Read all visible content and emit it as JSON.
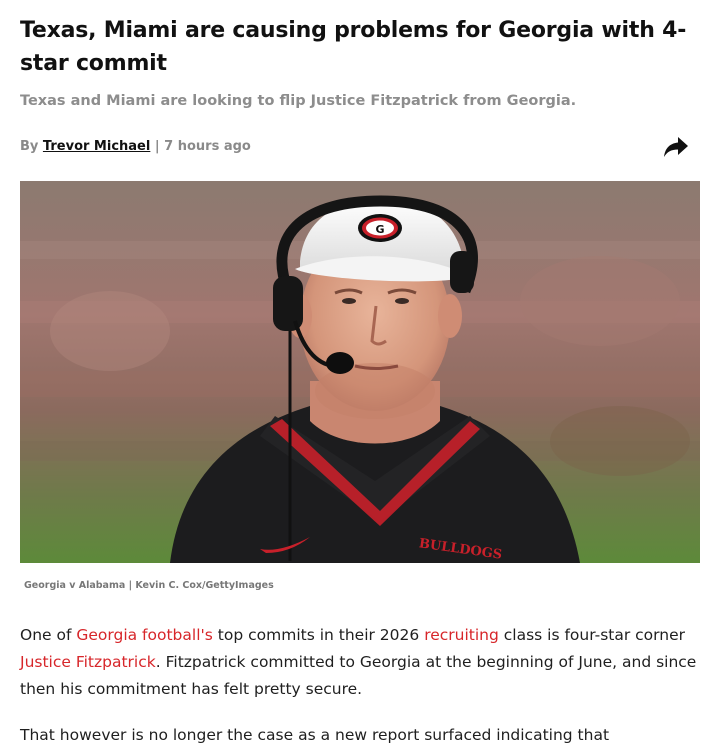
{
  "article": {
    "headline": "Texas, Miami are causing problems for Georgia with 4-star commit",
    "subheadline": "Texas and Miami are looking to flip Justice Fitzpatrick from Georgia.",
    "byline": {
      "prefix": "By",
      "author": "Trevor Michael",
      "separator": "|",
      "time": "7 hours ago"
    },
    "share_icon": "share-arrow-icon",
    "image": {
      "caption": "Georgia v Alabama | Kevin C. Cox/GettyImages",
      "visor_logo": "G",
      "shirt_text": "BULLDOGS"
    },
    "paragraph1": {
      "t1": "One of ",
      "link1": "Georgia football's",
      "t2": " top commits in their 2026 ",
      "link2": "recruiting",
      "t3": " class is four-star corner ",
      "link3": "Justice Fitzpatrick",
      "t4": ". Fitzpatrick committed to Georgia at the beginning of June, and since then his commitment has felt pretty secure."
    },
    "paragraph2": {
      "text": "That however is no longer the case as a new report surfaced indicating that"
    }
  },
  "colors": {
    "link": "#d7262a",
    "headline": "#111111",
    "muted": "#8d8d8d"
  }
}
